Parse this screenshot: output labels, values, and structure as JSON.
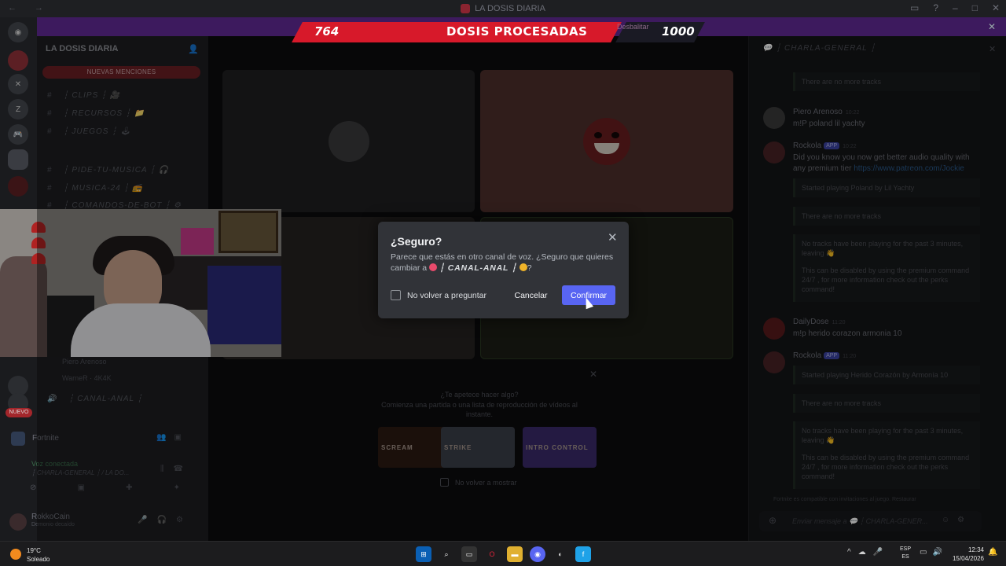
{
  "window": {
    "title": "LA DOSIS DIARIA"
  },
  "overlay": {
    "left_value": "764",
    "center_label": "DOSIS PROCESADAS",
    "tag": "Desbalitar",
    "right_value": "1000"
  },
  "sidebar": {
    "server_name": "LA DOSIS DIARIA",
    "new_mentions": "NUEVAS MENCIONES",
    "channels": [
      {
        "label": "┆ CLIPS ┆ 🎥"
      },
      {
        "label": "┆ RECURSOS ┆ 📁"
      },
      {
        "label": "┆ JUEGOS ┆ 🕹"
      },
      {
        "label": "┆ PIDE-TU-MUSICA ┆ 🎧"
      },
      {
        "label": "┆ MUSICA-24 ┆ 📻"
      },
      {
        "label": "┆ COMANDOS-DE-BOT ┆ ⚙"
      }
    ],
    "voice_users": [
      "Piero Arenoso",
      "WarneR · 4K4K"
    ],
    "voice_channel": "┆ CANAL-ANAL ┆",
    "nuevo": "NUEVO",
    "activity_game": "Fortnite",
    "voice_status": "Voz conectada",
    "voice_sub": "┆ CHARLA-GENERAL ┆ / LA DO...",
    "user_name": "RokkoCain",
    "user_status": "Demonio decaído"
  },
  "stage": {
    "activity_title": "¿Te apetece hacer algo?",
    "activity_sub": "Comienza una partida o una lista de reproducción de vídeos al instante.",
    "games": [
      "SCREAM",
      "STRIKE",
      "INTRO CONTROL"
    ],
    "no_show": "No volver a mostrar"
  },
  "chat": {
    "channel": "┆ CHARLA-GENERAL ┆",
    "messages": [
      {
        "embed": "There are no more tracks"
      },
      {
        "author": "Piero Arenoso",
        "time": "10:22",
        "text": "m!P poland lil yachty"
      },
      {
        "author": "Rockola",
        "badge": "APP",
        "time": "10:22",
        "text": "Did you know you now get better audio quality with any premium tier ",
        "link": "https://www.patreon.com/Jockie"
      },
      {
        "embed": "Started playing Poland by Lil Yachty"
      },
      {
        "embed": "There are no more tracks"
      },
      {
        "embed": "No tracks have been playing for the past 3 minutes, leaving 👋"
      },
      {
        "embed": "This can be disabled by using the premium command 24/7 , for more information check out the perks command!"
      },
      {
        "author": "DailyDose",
        "time": "11:20",
        "text": "m!p herido corazon armonia 10"
      },
      {
        "author": "Rockola",
        "badge": "APP",
        "time": "11:20",
        "embed": "Started playing Herido Corazón by Armonía 10"
      },
      {
        "embed": "There are no more tracks"
      },
      {
        "embed": "No tracks have been playing for the past 3 minutes, leaving 👋"
      },
      {
        "embed": "This can be disabled by using the premium command 24/7 , for more information check out the perks command!"
      }
    ],
    "footer_note": "Fortnite es compatible con invitaciones al juego. Restaurar",
    "input_placeholder": "Enviar mensaje a 💬 ┆ CHARLA-GENER..."
  },
  "modal": {
    "title": "¿Seguro?",
    "body_prefix": "Parece que estás en otro canal de voz. ¿Seguro que quieres cambiar a",
    "channel": "┆ CANAL-ANAL ┆",
    "body_suffix": "?",
    "checkbox_label": "No volver a preguntar",
    "cancel": "Cancelar",
    "confirm": "Confirmar"
  },
  "taskbar": {
    "temp": "19°C",
    "weather": "Soleado",
    "lang1": "ESP",
    "lang2": "ES",
    "time": "12:34",
    "date": "15/04/2026"
  },
  "colors": {
    "accent": "#5865f2",
    "overlay_red": "#d7192a",
    "overlay_purple": "#3d1a5e"
  }
}
